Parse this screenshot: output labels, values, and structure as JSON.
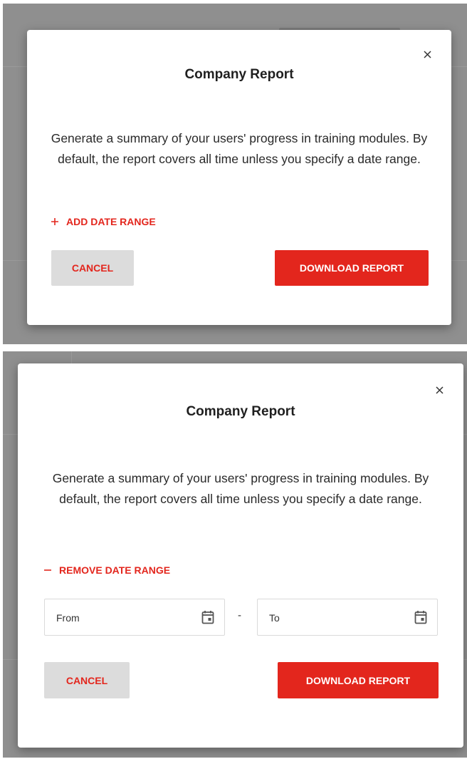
{
  "colors": {
    "accent": "#e3261d",
    "overlay": "#8f8f8f",
    "cancel_bg": "#dcdcdc"
  },
  "state_collapsed": {
    "title": "Company Report",
    "description": "Generate a summary of your users' progress in training modules. By default, the report covers all time unless you specify a date range.",
    "toggle_icon": "plus-icon",
    "toggle_label": "ADD DATE RANGE",
    "cancel_label": "CANCEL",
    "download_label": "DOWNLOAD REPORT",
    "close_icon": "close-icon"
  },
  "state_expanded": {
    "title": "Company Report",
    "description": "Generate a summary of your users' progress in training modules. By default, the report covers all time unless you specify a date range.",
    "toggle_icon": "minus-icon",
    "toggle_label": "REMOVE DATE RANGE",
    "from_placeholder": "From",
    "range_separator": "-",
    "to_placeholder": "To",
    "calendar_icon": "calendar-icon",
    "cancel_label": "CANCEL",
    "download_label": "DOWNLOAD REPORT",
    "close_icon": "close-icon"
  }
}
